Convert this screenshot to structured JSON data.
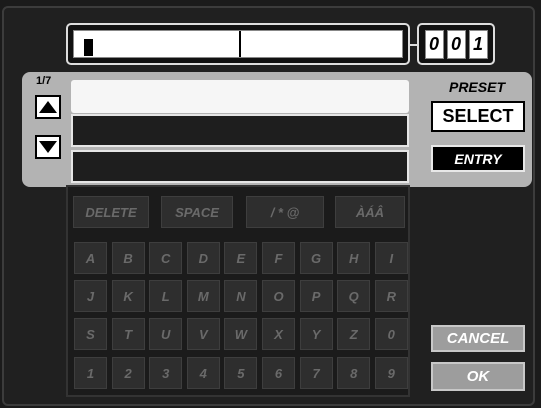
{
  "name_field": {
    "value": ""
  },
  "counter": {
    "digits": [
      "0",
      "0",
      "1"
    ]
  },
  "preset": {
    "page_indicator": "1/7",
    "label": "PRESET",
    "select_label": "SELECT",
    "entry_label": "ENTRY",
    "slots": [
      "",
      "",
      ""
    ]
  },
  "keyboard": {
    "function_keys": [
      "DELETE",
      "SPACE",
      "/ * @",
      "ÀÁÂ"
    ],
    "rows": [
      [
        "A",
        "B",
        "C",
        "D",
        "E",
        "F",
        "G",
        "H",
        "I"
      ],
      [
        "J",
        "K",
        "L",
        "M",
        "N",
        "O",
        "P",
        "Q",
        "R"
      ],
      [
        "S",
        "T",
        "U",
        "V",
        "W",
        "X",
        "Y",
        "Z",
        "0"
      ],
      [
        "1",
        "2",
        "3",
        "4",
        "5",
        "6",
        "7",
        "8",
        "9"
      ]
    ]
  },
  "actions": {
    "cancel_label": "CANCEL",
    "ok_label": "OK"
  }
}
